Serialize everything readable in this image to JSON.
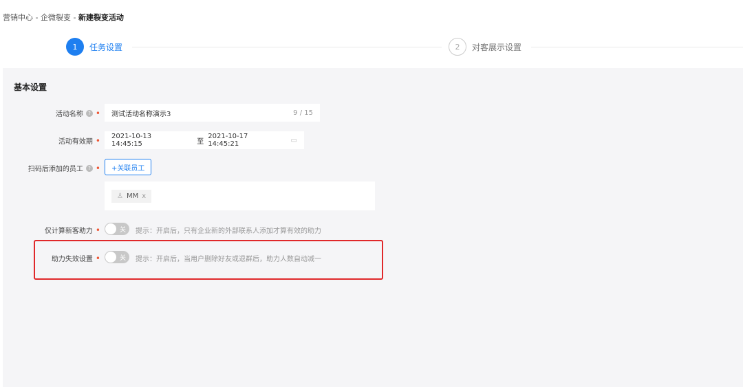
{
  "breadcrumb": {
    "items": [
      "营销中心",
      "企微裂变"
    ],
    "current": "新建裂变活动",
    "sep": " - "
  },
  "steps": [
    {
      "num": "1",
      "label": "任务设置"
    },
    {
      "num": "2",
      "label": "对客展示设置"
    }
  ],
  "section_title": "基本设置",
  "form": {
    "name": {
      "label": "活动名称",
      "value": "测试活动名称演示3",
      "count": "9 / 15"
    },
    "period": {
      "label": "活动有效期",
      "start": "2021-10-13 14:45:15",
      "to": "至",
      "end": "2021-10-17 14:45:21"
    },
    "staff": {
      "label": "扫码后添加的员工",
      "button": "+关联员工",
      "tags": [
        {
          "name": "MM",
          "remove": "x"
        }
      ]
    },
    "new_only": {
      "label": "仅计算新客助力",
      "switch": "关",
      "tip": "提示：开启后，只有企业新的外部联系人添加才算有效的助力"
    },
    "invalid": {
      "label": "助力失效设置",
      "switch": "关",
      "tip": "提示：开启后，当用户删除好友或退群后，助力人数自动减一"
    }
  },
  "colors": {
    "primary": "#1e7ff0",
    "highlight": "#e0282a"
  }
}
